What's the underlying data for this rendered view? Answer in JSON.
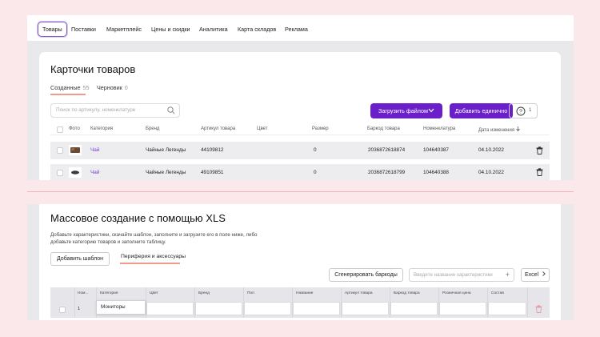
{
  "nav": {
    "items": [
      "Товары",
      "Поставки",
      "Маркетплейс",
      "Цены и скидки",
      "Аналитика",
      "Карта складов",
      "Реклама"
    ],
    "active": "Товары"
  },
  "products": {
    "title": "Карточки товаров",
    "tabs": [
      {
        "label": "Созданные",
        "count": "55"
      },
      {
        "label": "Черновик",
        "count": "0"
      }
    ],
    "search_placeholder": "Поиск по артикулу, номенклатуре",
    "upload_button": "Загрузить файлом",
    "add_button": "Добавить единично",
    "help_count": "1",
    "columns": [
      "Фото",
      "Категория",
      "Бренд",
      "Артикул товара",
      "Цвет",
      "Размер",
      "Баркод товара",
      "Номенклатура",
      "Дата изменения"
    ],
    "rows": [
      {
        "category": "Чай",
        "brand": "Чайные Легенды",
        "article": "44109812",
        "color": "",
        "size": "0",
        "barcode": "2036872618874",
        "nomenclature": "104640387",
        "date": "04.10.2022"
      },
      {
        "category": "Чай",
        "brand": "Чайные Легенды",
        "article": "49109851",
        "color": "",
        "size": "0",
        "barcode": "2036872618799",
        "nomenclature": "104640388",
        "date": "04.10.2022"
      }
    ]
  },
  "mass": {
    "title": "Массовое создание с помощью XLS",
    "description": "Добавьте характеристики, скачайте шаблон, заполните и загрузите его в поле ниже, либо добавьте категорию товаров и заполните таблицу.",
    "add_template_button": "Добавить шаблон",
    "category_tab": "Периферия и аксессуары",
    "barcodes_button": "Сгенерировать баркоды",
    "char_placeholder": "Введите название характеристики",
    "excel_button": "Excel",
    "grid_headers": [
      "Ном...",
      "Категория",
      "Цвет",
      "Бренд",
      "Пол",
      "Название",
      "Артикул товара",
      "Баркод товара",
      "Розничная цена",
      "Состав"
    ],
    "row_number": "1",
    "category_value": "Мониторы"
  },
  "colors": {
    "accent": "#6a1fcb",
    "link": "#7a3ad0",
    "background": "#fbe8ea",
    "underline": "#f29a8e"
  }
}
